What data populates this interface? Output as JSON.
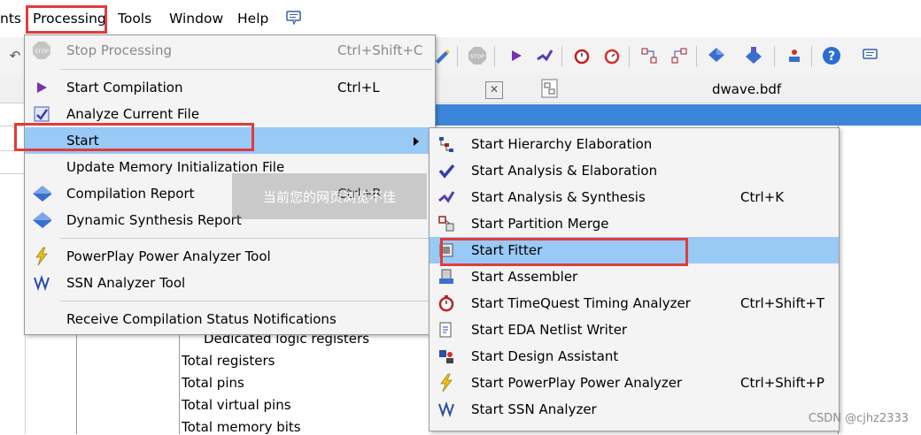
{
  "menubar": {
    "items": [
      "nts",
      "Processing",
      "Tools",
      "Window",
      "Help"
    ],
    "notes_icon": "notes-icon"
  },
  "doc": {
    "tab_title": "dwave.bdf"
  },
  "summary": {
    "lines": [
      "Dedicated logic registers",
      "Total registers",
      "Total pins",
      "Total virtual pins",
      "Total memory bits"
    ]
  },
  "processing_menu": {
    "items": [
      {
        "label": "Stop Processing",
        "shortcut": "Ctrl+Shift+C",
        "icon": "stop-icon",
        "disabled": true
      },
      {
        "label": "Start Compilation",
        "shortcut": "Ctrl+L",
        "icon": "play-icon"
      },
      {
        "label": "Analyze Current File",
        "shortcut": "",
        "icon": "analyze-file-icon"
      },
      {
        "label": "Start",
        "shortcut": "",
        "icon": "",
        "submenu": true
      },
      {
        "label": "Update Memory Initialization File",
        "shortcut": "",
        "icon": ""
      },
      {
        "label": "Compilation Report",
        "shortcut": "Ctrl+R",
        "icon": "report-icon"
      },
      {
        "label": "Dynamic Synthesis Report",
        "shortcut": "",
        "icon": "report-icon"
      },
      {
        "label": "PowerPlay Power Analyzer Tool",
        "shortcut": "",
        "icon": "power-icon"
      },
      {
        "label": "SSN Analyzer Tool",
        "shortcut": "",
        "icon": "ssn-icon"
      },
      {
        "label": "Receive Compilation Status Notifications",
        "shortcut": "",
        "icon": ""
      }
    ]
  },
  "start_submenu": {
    "items": [
      {
        "label": "Start Hierarchy Elaboration",
        "shortcut": "",
        "icon": "hierarchy-icon"
      },
      {
        "label": "Start Analysis & Elaboration",
        "shortcut": "",
        "icon": "check-icon"
      },
      {
        "label": "Start Analysis & Synthesis",
        "shortcut": "Ctrl+K",
        "icon": "synthesis-icon"
      },
      {
        "label": "Start Partition Merge",
        "shortcut": "",
        "icon": "partition-icon"
      },
      {
        "label": "Start Fitter",
        "shortcut": "",
        "icon": "fitter-icon"
      },
      {
        "label": "Start Assembler",
        "shortcut": "",
        "icon": "assembler-icon"
      },
      {
        "label": "Start TimeQuest Timing Analyzer",
        "shortcut": "Ctrl+Shift+T",
        "icon": "timer-icon"
      },
      {
        "label": "Start EDA Netlist Writer",
        "shortcut": "",
        "icon": "netlist-icon"
      },
      {
        "label": "Start Design Assistant",
        "shortcut": "",
        "icon": "assistant-icon"
      },
      {
        "label": "Start PowerPlay Power Analyzer",
        "shortcut": "Ctrl+Shift+P",
        "icon": "power-icon"
      },
      {
        "label": "Start SSN Analyzer",
        "shortcut": "",
        "icon": "ssn-icon"
      }
    ]
  },
  "overlay": {
    "watermark_text": "当前您的网页浏览不佳",
    "credit": "CSDN @cjhz2333"
  },
  "colors": {
    "highlight": "#99c9f5",
    "red_box": "#e03c3c",
    "title_blue": "#3c86d8"
  }
}
